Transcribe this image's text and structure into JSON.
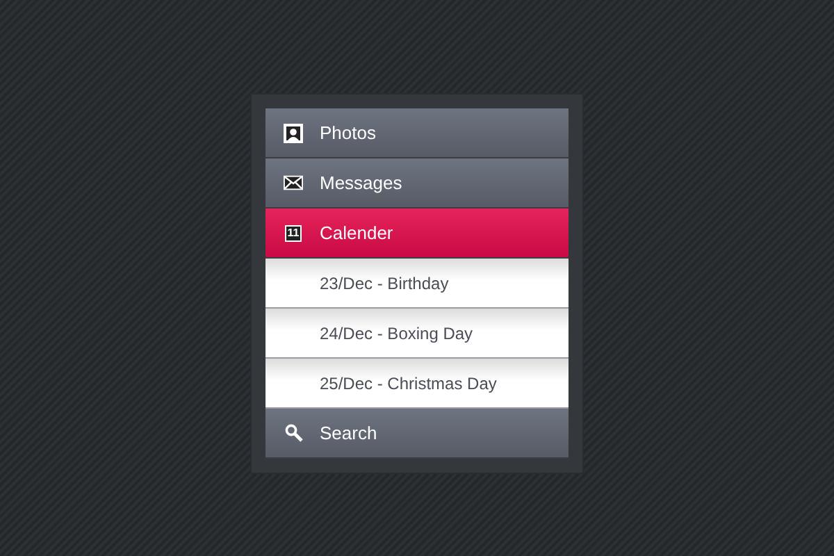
{
  "menu": [
    {
      "label": "Photos",
      "selected": false
    },
    {
      "label": "Messages",
      "selected": false
    },
    {
      "label": "Calender",
      "selected": true,
      "icon_text": "11",
      "expanded": true,
      "children": [
        {
          "label": "23/Dec - Birthday"
        },
        {
          "label": "24/Dec - Boxing Day"
        },
        {
          "label": "25/Dec - Christmas Day"
        }
      ]
    },
    {
      "label": "Search",
      "selected": false
    }
  ]
}
